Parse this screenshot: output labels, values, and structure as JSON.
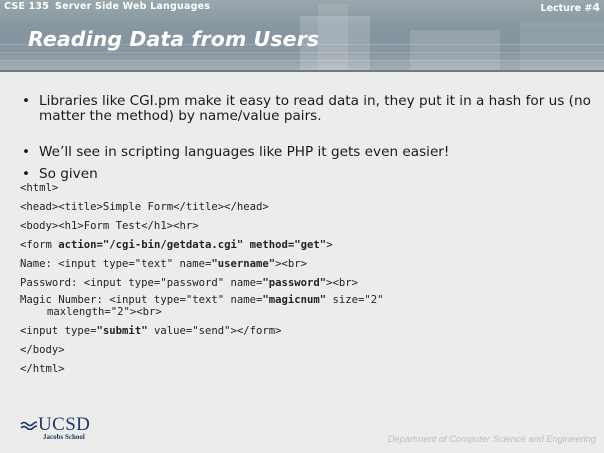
{
  "header": {
    "course_code": "CSE 135",
    "course_name": "Server Side Web Languages",
    "lecture_label": "Lecture #",
    "lecture_number": "4",
    "title": "Reading Data from Users"
  },
  "bullets": [
    "Libraries like CGI.pm make it easy to read data in, they put it in a hash for us (no matter the method) by name/value pairs.",
    "We’ll see in scripting languages like PHP it gets even easier!",
    "So given"
  ],
  "code": {
    "html_open": "<html>",
    "head": "<head><title>Simple Form</title></head>",
    "body_open": "<body><h1>Form Test</h1><hr>",
    "form_pre": "<form ",
    "form_action": "action=\"/cgi-bin/getdata.cgi\"",
    "form_method": "method=\"get\"",
    "form_post": ">",
    "name_pre": "Name: <input type=\"text\" name=",
    "name_val": "\"username\"",
    "name_post": "><br>",
    "pw_pre": "Password: <input type=\"password\" name=",
    "pw_val": "\"password\"",
    "pw_post": "><br>",
    "magic_pre": "Magic Number: <input type=\"text\" name=",
    "magic_val": "\"magicnum\"",
    "magic_post": " size=\"2\"",
    "magic_cont": "maxlength=\"2\"><br>",
    "submit_pre": "<input type=",
    "submit_val": "\"submit\"",
    "submit_post": " value=\"send\"></form>",
    "body_close": "</body>",
    "html_close": "</html>"
  },
  "footer": {
    "logo_text": "UCSD",
    "logo_sub": "Jacobs School",
    "department": "Department of Computer Science and Engineering"
  },
  "colors": {
    "header": "#8596a0",
    "logo": "#1f3a68",
    "body_bg": "#ececea"
  }
}
